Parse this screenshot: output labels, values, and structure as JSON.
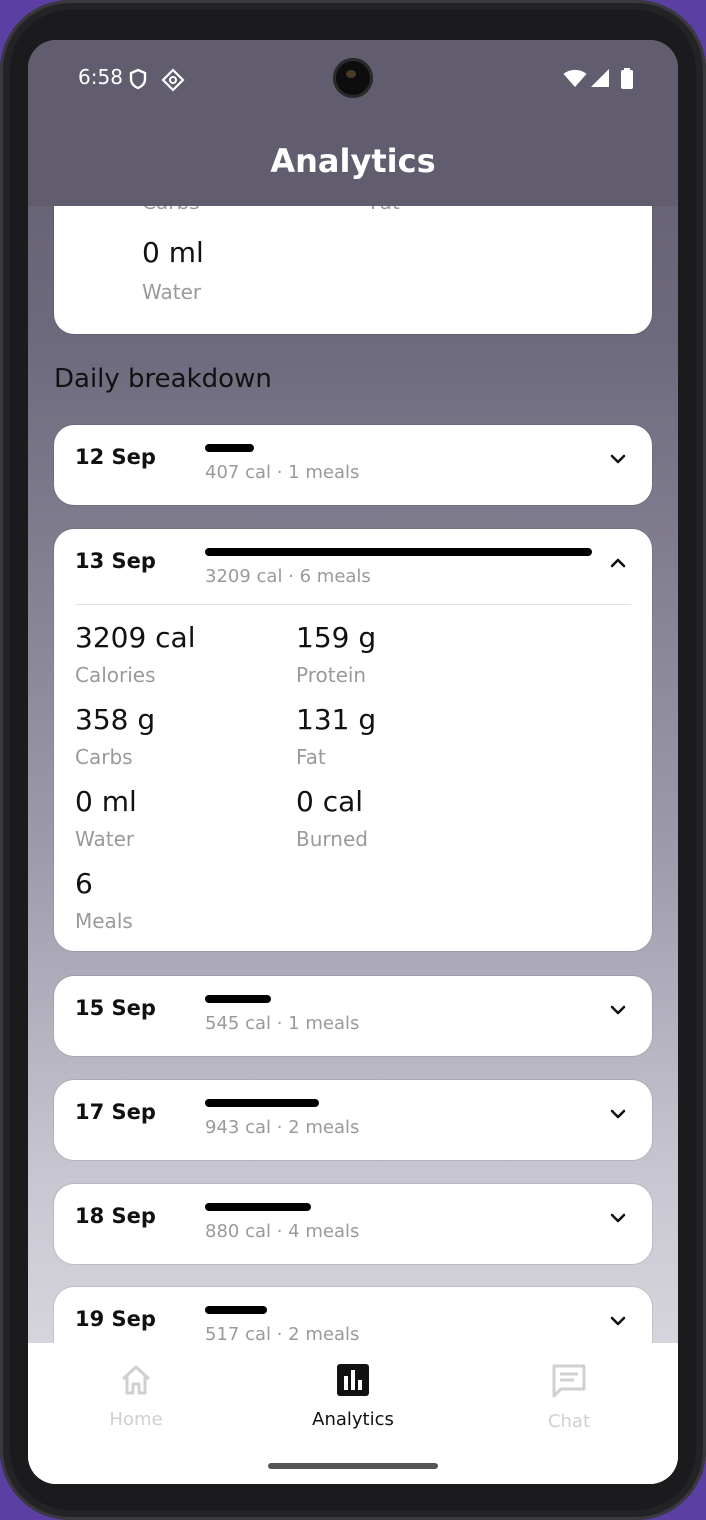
{
  "status": {
    "time": "6:58"
  },
  "appbar": {
    "title": "Analytics"
  },
  "summary": {
    "carbs_label": "Carbs",
    "fat_label": "Fat",
    "water_value": "0 ml",
    "water_label": "Water"
  },
  "section_title": "Daily breakdown",
  "days": [
    {
      "date": "12 Sep",
      "subtitle": "407 cal · 1 meals",
      "calories": 407,
      "expanded": false
    },
    {
      "date": "13 Sep",
      "subtitle": "3209 cal · 6 meals",
      "calories": 3209,
      "expanded": true,
      "stats": [
        {
          "value": "3209 cal",
          "label": "Calories"
        },
        {
          "value": "159 g",
          "label": "Protein"
        },
        {
          "value": "358 g",
          "label": "Carbs"
        },
        {
          "value": "131 g",
          "label": "Fat"
        },
        {
          "value": "0 ml",
          "label": "Water"
        },
        {
          "value": "0 cal",
          "label": "Burned"
        },
        {
          "value": "6",
          "label": "Meals"
        }
      ]
    },
    {
      "date": "15 Sep",
      "subtitle": "545 cal · 1 meals",
      "calories": 545,
      "expanded": false
    },
    {
      "date": "17 Sep",
      "subtitle": "943 cal · 2 meals",
      "calories": 943,
      "expanded": false
    },
    {
      "date": "18 Sep",
      "subtitle": "880 cal · 4 meals",
      "calories": 880,
      "expanded": false
    },
    {
      "date": "19 Sep",
      "subtitle": "517 cal · 2 meals",
      "calories": 517,
      "expanded": false
    }
  ],
  "nav": {
    "home": "Home",
    "analytics": "Analytics",
    "chat": "Chat",
    "active": "analytics",
    "active_color": "#111111",
    "inactive_color": "#d0d0d0"
  }
}
